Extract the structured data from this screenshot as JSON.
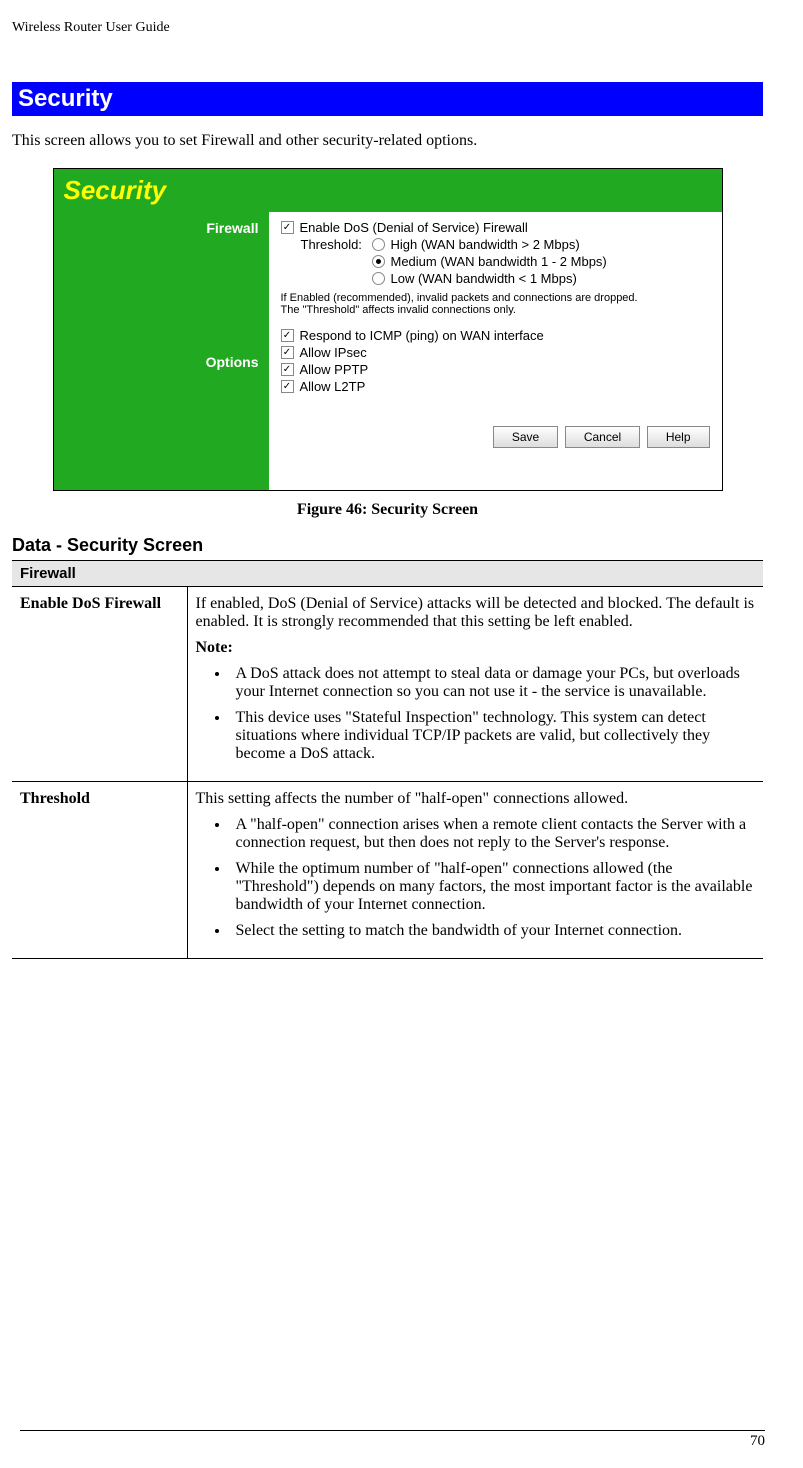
{
  "doc": {
    "header": "Wireless Router User Guide",
    "section_title": "Security",
    "intro": "This screen allows you to set Firewall and other security-related options.",
    "figure_caption": "Figure 46: Security Screen",
    "subheading": "Data - Security Screen",
    "page_number": "70"
  },
  "screenshot": {
    "title": "Security",
    "left_labels": {
      "firewall": "Firewall",
      "options": "Options"
    },
    "enable_dos": "Enable DoS (Denial of Service) Firewall",
    "threshold_label": "Threshold:",
    "thresholds": {
      "high": "High (WAN bandwidth > 2 Mbps)",
      "medium": "Medium (WAN bandwidth 1 - 2 Mbps)",
      "low": "Low (WAN bandwidth < 1 Mbps)"
    },
    "note_line1": "If Enabled (recommended), invalid packets and connections are dropped.",
    "note_line2": "The \"Threshold\" affects invalid connections only.",
    "options": {
      "icmp": "Respond to ICMP (ping) on WAN interface",
      "ipsec": "Allow IPsec",
      "pptp": "Allow PPTP",
      "l2tp": "Allow L2TP"
    },
    "buttons": {
      "save": "Save",
      "cancel": "Cancel",
      "help": "Help"
    }
  },
  "table": {
    "group_header": "Firewall",
    "row1": {
      "label": "Enable DoS Firewall",
      "p1": "If enabled, DoS (Denial of Service) attacks will be detected and blocked. The default is enabled. It is strongly recommended that this setting be left enabled.",
      "note_label": "Note:",
      "b1": "A DoS attack does not attempt to steal data or damage your PCs, but overloads your Internet connection so you can not use it - the service is unavailable.",
      "b2": "This device uses \"Stateful Inspection\" technology. This system can detect situations where individual TCP/IP packets are valid, but collectively they become a DoS attack."
    },
    "row2": {
      "label": "Threshold",
      "p1": "This setting affects the number of \"half-open\" connections allowed.",
      "b1": "A \"half-open\" connection arises when a remote client contacts the Server with a connection request, but then does not reply to the Server's response.",
      "b2": "While the optimum number of \"half-open\" connections allowed (the \"Threshold\") depends on many factors, the most important factor is the available bandwidth of your Internet connection.",
      "b3": "Select the setting to match the bandwidth of your Internet connection."
    }
  }
}
